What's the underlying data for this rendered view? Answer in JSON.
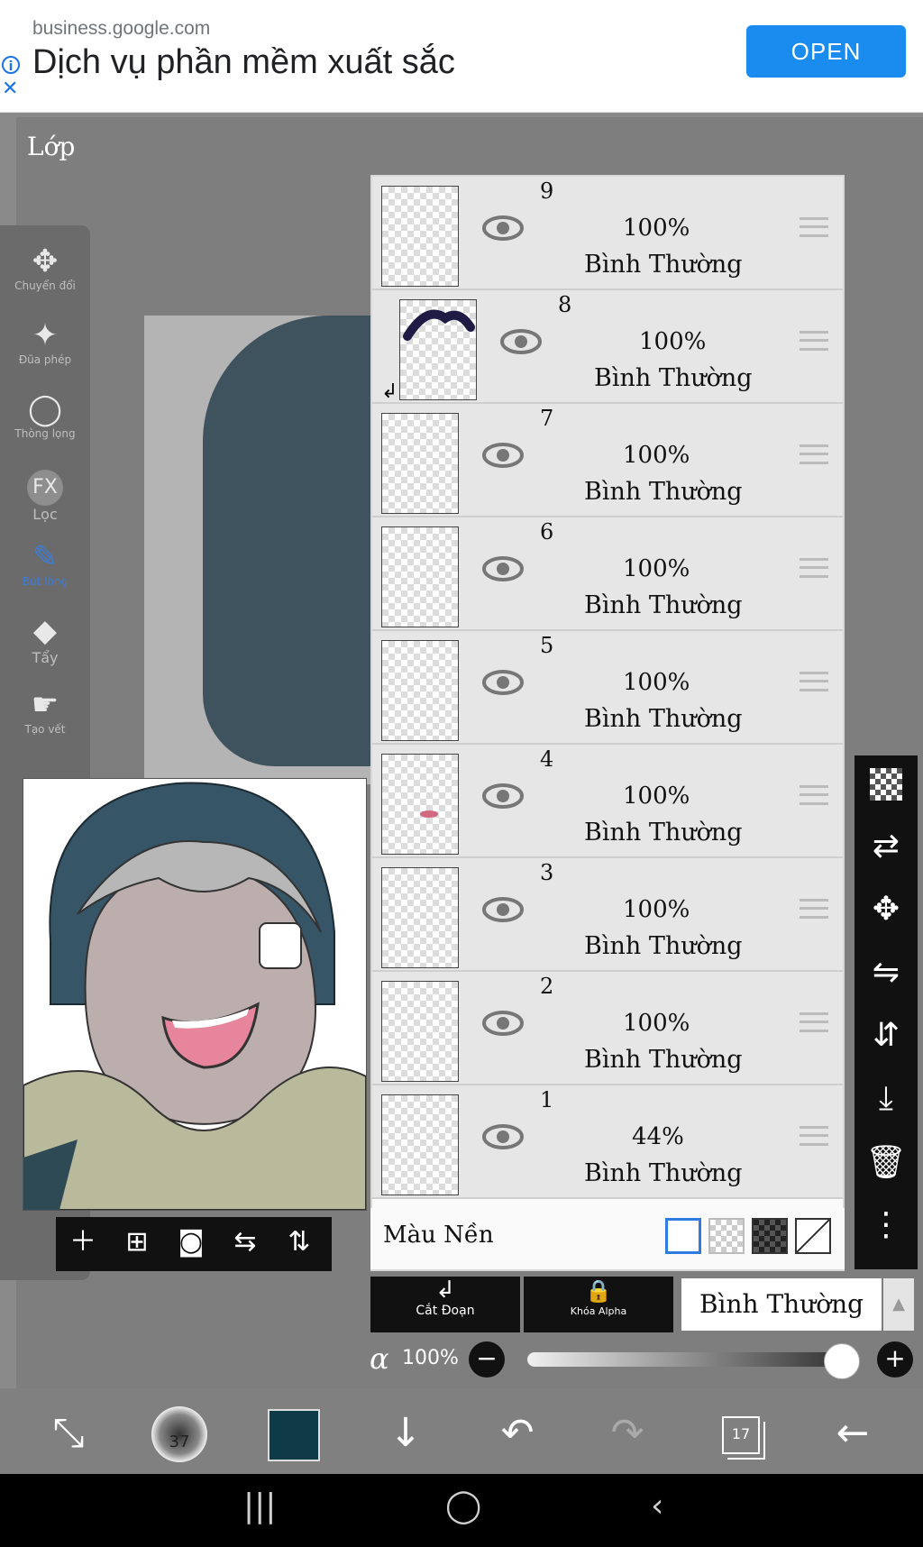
{
  "ad": {
    "domain": "business.google.com",
    "title": "Dịch vụ phần mềm xuất sắc",
    "open_label": "OPEN",
    "info_icon": "info-icon",
    "close_icon": "close-icon"
  },
  "panel_title": "Lớp",
  "left_tools": [
    {
      "label": "Chuyển đổi",
      "icon": "move-arrows-icon"
    },
    {
      "label": "Đũa phép",
      "icon": "magic-wand-icon"
    },
    {
      "label": "Thòng lọng",
      "icon": "lasso-icon"
    },
    {
      "label": "Lọc",
      "icon": "fx-filter-icon"
    },
    {
      "label": "Bút lông",
      "icon": "brush-icon"
    },
    {
      "label": "Tẩy",
      "icon": "eraser-icon"
    },
    {
      "label": "Tạo vết",
      "icon": "smudge-icon"
    }
  ],
  "left_tools_extra": {
    "fx": "FX"
  },
  "layers": [
    {
      "number": "9",
      "opacity": "100%",
      "blend": "Bình Thường"
    },
    {
      "number": "8",
      "opacity": "100%",
      "blend": "Bình Thường"
    },
    {
      "number": "7",
      "opacity": "100%",
      "blend": "Bình Thường"
    },
    {
      "number": "6",
      "opacity": "100%",
      "blend": "Bình Thường"
    },
    {
      "number": "5",
      "opacity": "100%",
      "blend": "Bình Thường"
    },
    {
      "number": "4",
      "opacity": "100%",
      "blend": "Bình Thường"
    },
    {
      "number": "3",
      "opacity": "100%",
      "blend": "Bình Thường"
    },
    {
      "number": "2",
      "opacity": "100%",
      "blend": "Bình Thường"
    },
    {
      "number": "1",
      "opacity": "44%",
      "blend": "Bình Thường"
    }
  ],
  "background": {
    "label": "Màu Nền"
  },
  "controls": {
    "clip_label": "Cắt Đoạn",
    "alpha_lock_label": "Khóa Alpha",
    "blend_mode": "Bình Thường",
    "alpha_symbol": "α",
    "opacity": "100%"
  },
  "bottom": {
    "brush_size": "37",
    "layer_count": "17",
    "primary_color": "#0f3a48"
  },
  "colors": {
    "ad_open": "#1a8cf0",
    "toolbar_bg": "#111111",
    "hat": "#324854"
  }
}
